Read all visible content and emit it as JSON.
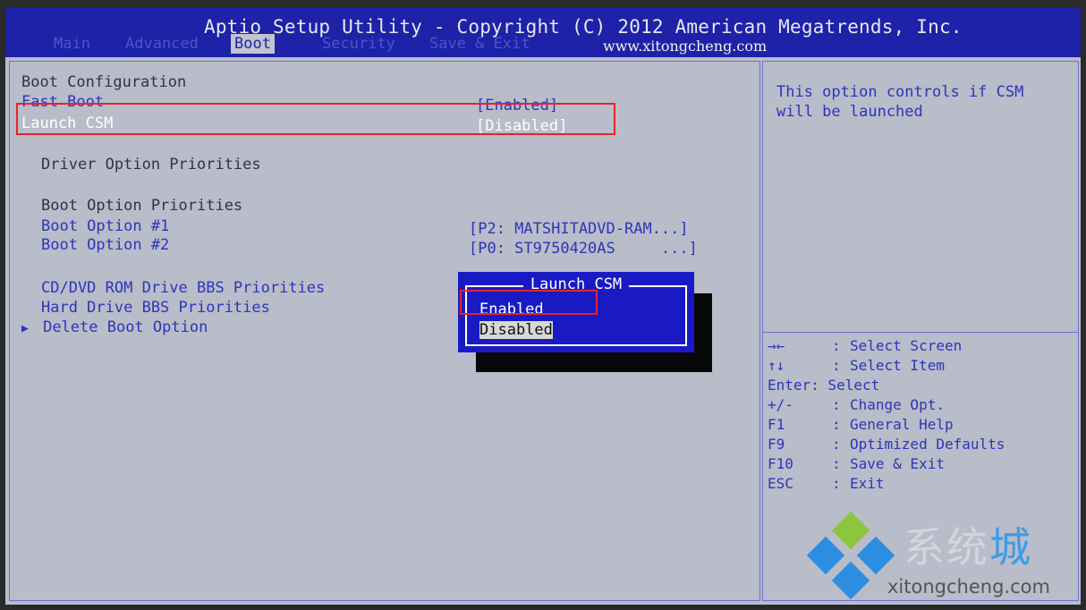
{
  "header": {
    "title": "Aptio Setup Utility - Copyright (C) 2012 American Megatrends, Inc.",
    "url": "www.xitongcheng.com",
    "tabs": [
      {
        "label": "Main",
        "active": false
      },
      {
        "label": "Advanced",
        "active": false
      },
      {
        "label": "Boot",
        "active": true
      },
      {
        "label": "Security",
        "active": false
      },
      {
        "label": "Save & Exit",
        "active": false
      }
    ]
  },
  "main": {
    "boot_configuration": "Boot Configuration",
    "fast_boot": {
      "label": "Fast Boot",
      "value": "[Enabled]"
    },
    "launch_csm": {
      "label": "Launch CSM",
      "value": "[Disabled]"
    },
    "driver_option_priorities": "Driver Option Priorities",
    "boot_option_priorities": "Boot Option Priorities",
    "boot_option_1": {
      "label": "Boot Option #1",
      "value": "[P2: MATSHITADVD-RAM...]"
    },
    "boot_option_2": {
      "label": "Boot Option #2",
      "value": "[P0: ST9750420AS     ...]"
    },
    "cd_dvd": "CD/DVD ROM Drive BBS Priorities",
    "hard_drive": "Hard Drive BBS Priorities",
    "delete_boot": "Delete Boot Option",
    "submenu_arrow": "▶"
  },
  "popup": {
    "title": "Launch CSM",
    "options": [
      "Enabled",
      "Disabled"
    ],
    "selected": "Disabled"
  },
  "help": {
    "line1": "This option controls if CSM",
    "line2": "will be launched",
    "keys": [
      {
        "key": "→←",
        "desc": "Select Screen"
      },
      {
        "key": "↑↓",
        "desc": "Select Item"
      },
      {
        "key": "Enter",
        "desc": "Select"
      },
      {
        "key": "+/-",
        "desc": "Change Opt."
      },
      {
        "key": "F1",
        "desc": "General Help"
      },
      {
        "key": "F9",
        "desc": "Optimized Defaults"
      },
      {
        "key": "F10",
        "desc": "Save & Exit"
      },
      {
        "key": "ESC",
        "desc": "Exit"
      }
    ]
  },
  "watermark": {
    "cn_1": "系统",
    "cn_2": "城",
    "url": "xitongcheng.com"
  },
  "colors": {
    "title_bar": "#1d22a8",
    "body": "#b9bcc9",
    "text_blue": "#2c36b8",
    "popup": "#1a1ac4",
    "highlight_red": "#e8232b"
  }
}
